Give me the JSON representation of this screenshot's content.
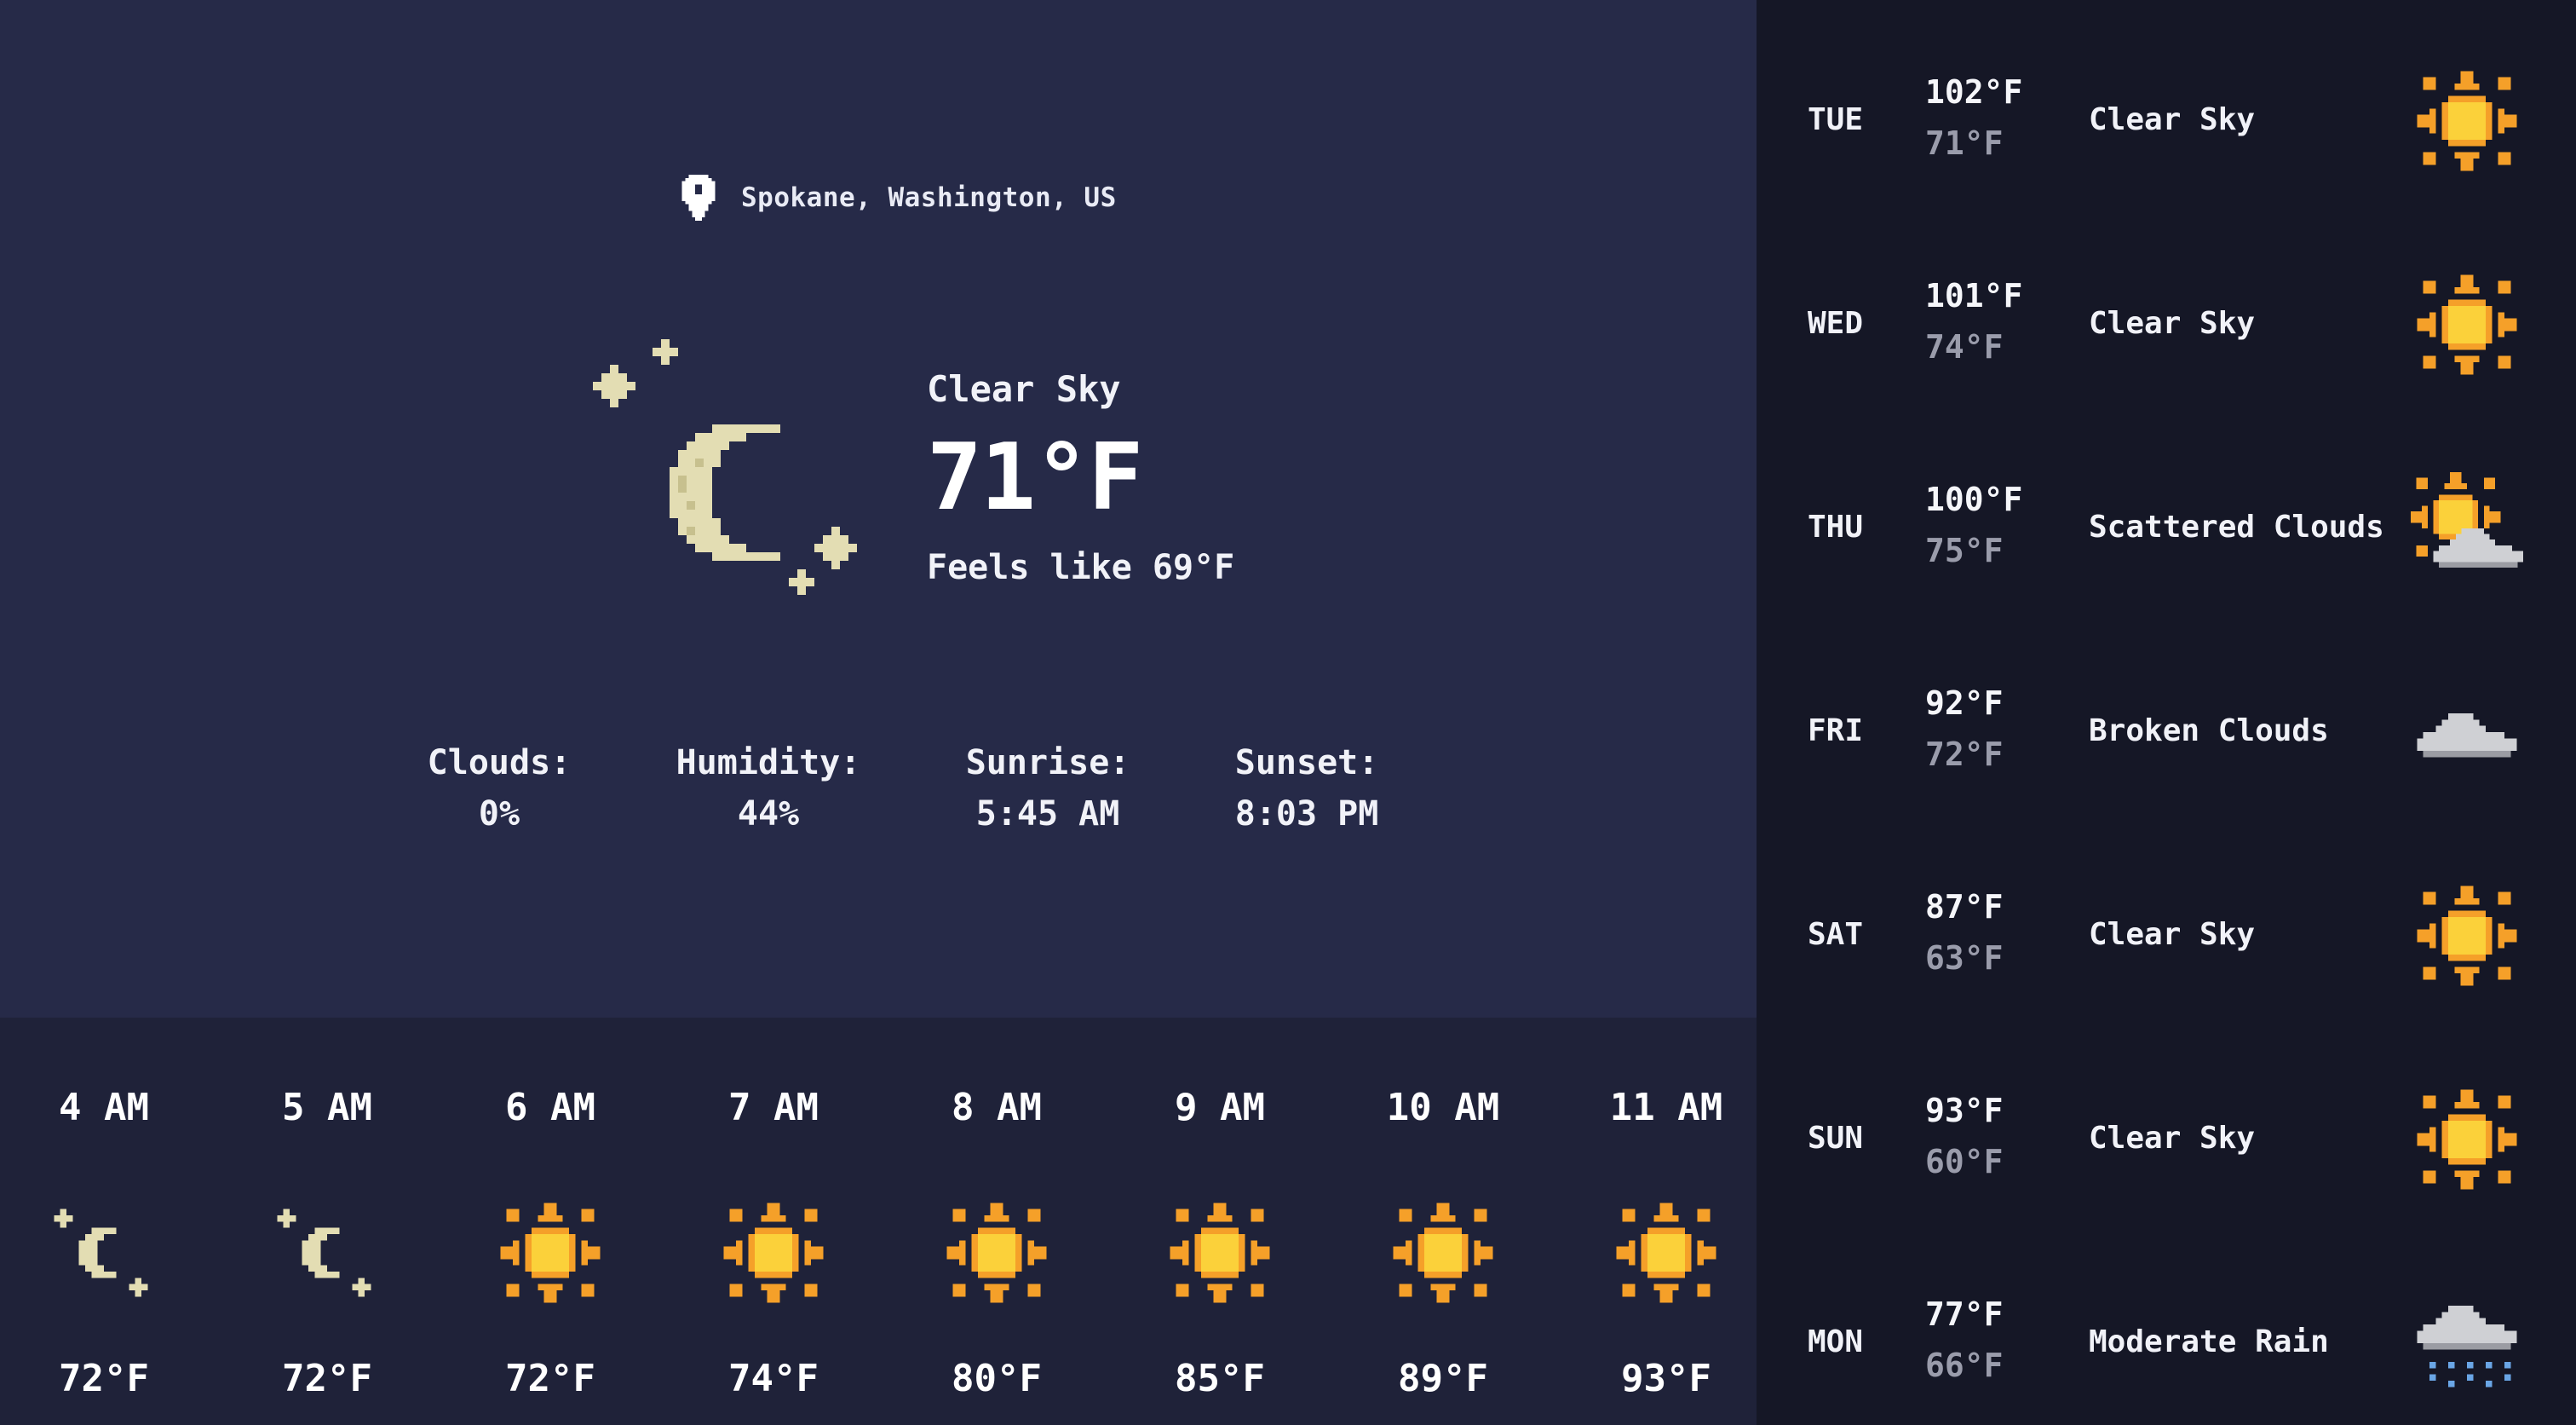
{
  "location": {
    "text": "Spokane, Washington, US",
    "icon": "map-pin-icon"
  },
  "current": {
    "icon": "crescent-moon-stars-icon",
    "description": "Clear Sky",
    "temperature": "71°F",
    "feels_like": "Feels like 69°F"
  },
  "stats": [
    {
      "label": "Clouds:",
      "value": "0%"
    },
    {
      "label": "Humidity:",
      "value": "44%"
    },
    {
      "label": "Sunrise:",
      "value": "5:45 AM"
    },
    {
      "label": "Sunset:",
      "value": "8:03 PM"
    }
  ],
  "hourly": [
    {
      "time": "4 AM",
      "icon": "moon-icon",
      "temp": "72°F"
    },
    {
      "time": "5 AM",
      "icon": "moon-icon",
      "temp": "72°F"
    },
    {
      "time": "6 AM",
      "icon": "sun-icon",
      "temp": "72°F"
    },
    {
      "time": "7 AM",
      "icon": "sun-icon",
      "temp": "74°F"
    },
    {
      "time": "8 AM",
      "icon": "sun-icon",
      "temp": "80°F"
    },
    {
      "time": "9 AM",
      "icon": "sun-icon",
      "temp": "85°F"
    },
    {
      "time": "10 AM",
      "icon": "sun-icon",
      "temp": "89°F"
    },
    {
      "time": "11 AM",
      "icon": "sun-icon",
      "temp": "93°F"
    }
  ],
  "daily": [
    {
      "day": "TUE",
      "high": "102°F",
      "low": "71°F",
      "description": "Clear Sky",
      "icon": "sun-icon"
    },
    {
      "day": "WED",
      "high": "101°F",
      "low": "74°F",
      "description": "Clear Sky",
      "icon": "sun-icon"
    },
    {
      "day": "THU",
      "high": "100°F",
      "low": "75°F",
      "description": "Scattered Clouds",
      "icon": "sun-cloud-icon"
    },
    {
      "day": "FRI",
      "high": "92°F",
      "low": "72°F",
      "description": "Broken Clouds",
      "icon": "cloud-icon"
    },
    {
      "day": "SAT",
      "high": "87°F",
      "low": "63°F",
      "description": "Clear Sky",
      "icon": "sun-icon"
    },
    {
      "day": "SUN",
      "high": "93°F",
      "low": "60°F",
      "description": "Clear Sky",
      "icon": "sun-icon"
    },
    {
      "day": "MON",
      "high": "77°F",
      "low": "66°F",
      "description": "Moderate Rain",
      "icon": "rain-cloud-icon"
    }
  ],
  "colors": {
    "main_bg": "#262a48",
    "hourly_bg": "#1f2239",
    "daily_bg": "#151726",
    "sun_core": "#fbd13a",
    "sun_ray": "#f5a029",
    "moon": "#e3ddb3",
    "cloud": "#cfd0d4",
    "rain": "#6aa6e6",
    "low_temp": "#9a9cab"
  }
}
